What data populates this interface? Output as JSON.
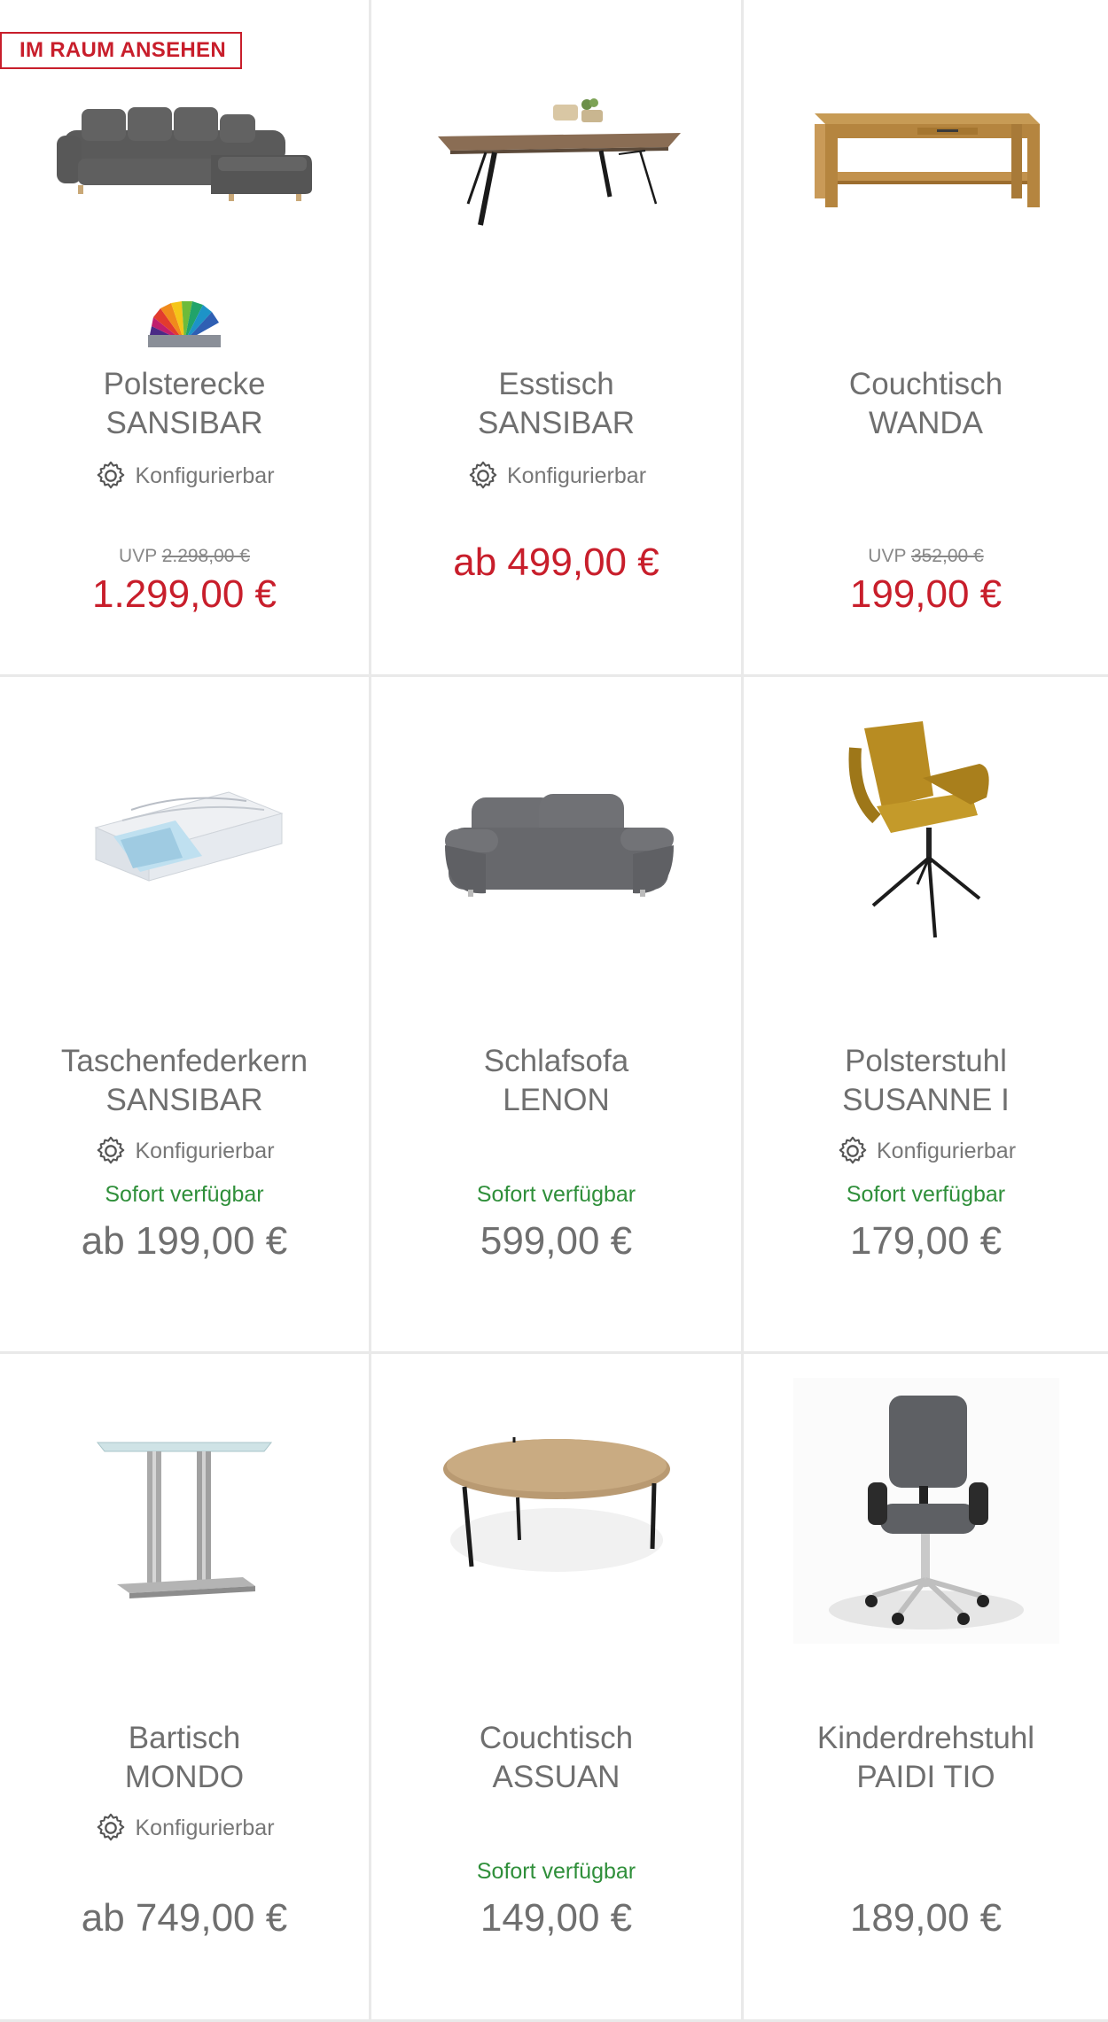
{
  "products": [
    {
      "badge": "IM RAUM ANSEHEN",
      "title1": "Polsterecke",
      "title2": "SANSIBAR",
      "config": "Konfigurierbar",
      "uvp_label": "UVP",
      "uvp_value": "2.298,00 €",
      "price": "1.299,00 €"
    },
    {
      "title1": "Esstisch",
      "title2": "SANSIBAR",
      "config": "Konfigurierbar",
      "price": "ab 499,00 €"
    },
    {
      "title1": "Couchtisch",
      "title2": "WANDA",
      "uvp_label": "UVP",
      "uvp_value": "352,00 €",
      "price": "199,00 €"
    },
    {
      "title1": "Taschenfederkern",
      "title2": "SANSIBAR",
      "config": "Konfigurierbar",
      "availability": "Sofort verfügbar",
      "price": "ab 199,00 €"
    },
    {
      "title1": "Schlafsofa",
      "title2": "LENON",
      "availability": "Sofort verfügbar",
      "price": "599,00 €"
    },
    {
      "title1": "Polsterstuhl",
      "title2": "SUSANNE I",
      "config": "Konfigurierbar",
      "availability": "Sofort verfügbar",
      "price": "179,00 €"
    },
    {
      "title1": "Bartisch",
      "title2": "MONDO",
      "config": "Konfigurierbar",
      "price": "ab 749,00 €"
    },
    {
      "title1": "Couchtisch",
      "title2": "ASSUAN",
      "availability": "Sofort verfügbar",
      "price": "149,00 €"
    },
    {
      "title1": "Kinderdrehstuhl",
      "title2": "PAIDI TIO",
      "price": "189,00 €"
    }
  ],
  "colors": {
    "accent_red": "#c81e2b",
    "available_green": "#2f8f3a",
    "text_gray": "#6f6f6f",
    "divider": "#e9e9e9"
  },
  "icons": {
    "config": "gear-icon",
    "color_options": "color-fan-icon"
  }
}
